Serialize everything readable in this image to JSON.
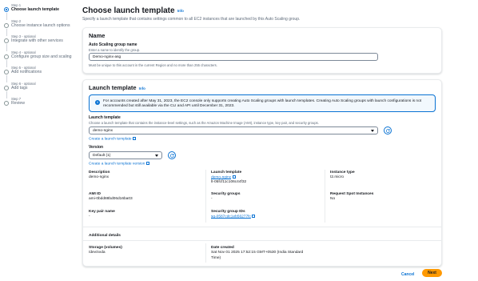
{
  "steps": [
    {
      "num": "Step 1",
      "label": "Choose launch template",
      "active": true
    },
    {
      "num": "Step 2",
      "label": "Choose instance launch options"
    },
    {
      "num": "Step 3 - optional",
      "label": "Integrate with other services"
    },
    {
      "num": "Step 4 - optional",
      "label": "Configure group size and scaling"
    },
    {
      "num": "Step 5 - optional",
      "label": "Add notifications"
    },
    {
      "num": "Step 6 - optional",
      "label": "Add tags"
    },
    {
      "num": "Step 7",
      "label": "Review"
    }
  ],
  "header": {
    "title": "Choose launch template",
    "info": "Info",
    "description": "Specify a launch template that contains settings common to all EC2 instances that are launched by this Auto Scaling group."
  },
  "name_panel": {
    "heading": "Name",
    "field_label": "Auto Scaling group name",
    "field_hint": "Enter a name to identify the group.",
    "field_value": "Demo-nginx-asg",
    "constraint": "Must be unique to this account in the current Region and no more than 255 characters."
  },
  "template_panel": {
    "heading": "Launch template",
    "info": "Info",
    "alert": "For accounts created after May 31, 2023, the EC2 console only supports creating Auto Scaling groups with launch templates. Creating Auto Scaling groups with launch configurations is not recommended but still available via the CLI and API until December 31, 2023.",
    "template_label": "Launch template",
    "template_hint": "Choose a launch template that contains the instance-level settings, such as the Amazon Machine Image (AMI), instance type, key pair, and security groups.",
    "template_value": "demo-nginx",
    "create_template_link": "Create a launch template",
    "version_label": "Version",
    "version_value": "Default (1)",
    "create_version_link": "Create a launch template version",
    "details": {
      "description_label": "Description",
      "description_value": "demo-nginx",
      "template_label": "Launch template",
      "template_link": "demo-nginx",
      "template_id": "lt-05fcf11c106c44f32",
      "instance_type_label": "Instance type",
      "instance_type_value": "t2.micro",
      "ami_label": "AMI ID",
      "ami_value": "ami-0bdd88bd06d16ba03",
      "sg_label": "Security groups",
      "sg_value": "-",
      "spot_label": "Request Spot Instances",
      "spot_value": "No",
      "keypair_label": "Key pair name",
      "keypair_value": "-",
      "sg_ids_label": "Security group IDs",
      "sg_ids_link": "sg-0587cdc1eb56277fc"
    },
    "additional": {
      "heading": "Additional details",
      "storage_label": "Storage (volumes)",
      "storage_value": "/dev/xvda",
      "date_label": "Date created",
      "date_value_1": "Sat Nov 01 2025 17:52:15 GMT+0530 (India Standard",
      "date_value_2": "Time)"
    }
  },
  "footer": {
    "cancel": "Cancel",
    "next": "Next"
  },
  "colors": {
    "accent": "#0972d3",
    "primary_button": "#ff9900"
  }
}
